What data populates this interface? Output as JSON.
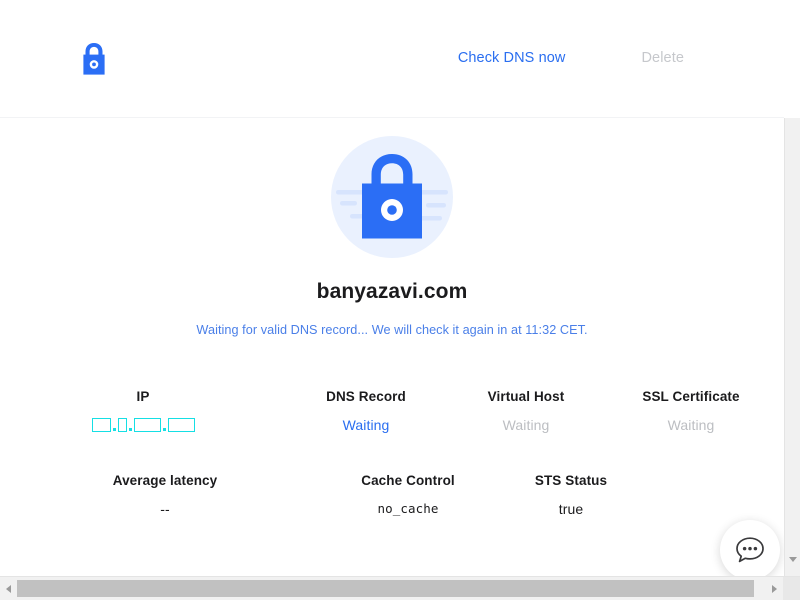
{
  "header": {
    "logo_icon": "padlock-icon",
    "check_dns_label": "Check DNS now",
    "delete_label": "Delete"
  },
  "hero": {
    "badge_icon": "padlock-badge-icon",
    "domain": "banyazavi.com",
    "status_message": "Waiting for valid DNS record... We will check it again in at 11:32 CET."
  },
  "stats": {
    "row1": [
      {
        "label": "IP",
        "value": "□.□.□.□",
        "style": "tofu"
      },
      {
        "label": "DNS Record",
        "value": "Waiting",
        "style": "blue"
      },
      {
        "label": "Virtual Host",
        "value": "Waiting",
        "style": "muted"
      },
      {
        "label": "SSL Certificate",
        "value": "Waiting",
        "style": "muted"
      }
    ],
    "row2": [
      {
        "label": "Average latency",
        "value": "--",
        "style": "plain"
      },
      {
        "label": "Cache Control",
        "value": "no_cache",
        "style": "mono"
      },
      {
        "label": "STS Status",
        "value": "true",
        "style": "plain"
      }
    ]
  },
  "chat": {
    "icon": "chat-bubble-icon",
    "title": "Open chat"
  },
  "colors": {
    "accent_blue": "#2a6ef0",
    "status_blue": "#4a7fe8",
    "muted_grey": "#bcbec2",
    "badge_bg": "#eaf1fe",
    "tofu_cyan": "#15dfe4",
    "text_dark": "#1b1b1d"
  },
  "scrollbars": {
    "vertical_present": true,
    "horizontal_present": true
  }
}
